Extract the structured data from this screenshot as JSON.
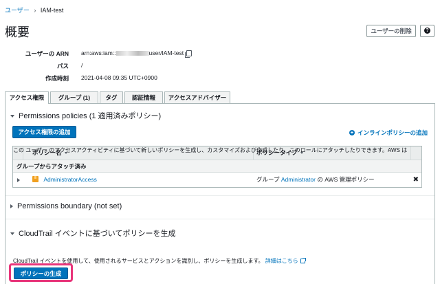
{
  "breadcrumb": {
    "users": "ユーザー",
    "separator": "›",
    "current": "IAM-test"
  },
  "header": {
    "title": "概要",
    "delete_button": "ユーザーの削除",
    "help_glyph": "?"
  },
  "summary": {
    "arn": {
      "label": "ユーザーの ARN",
      "prefix": "arn:aws:iam::",
      "suffix": "user/IAM-test"
    },
    "path": {
      "label": "パス",
      "value": "/"
    },
    "created": {
      "label": "作成時刻",
      "value": "2021-04-08 09:35 UTC+0900"
    }
  },
  "tabs": [
    {
      "label": "アクセス権限",
      "active": true
    },
    {
      "label": "グループ (1)",
      "active": false
    },
    {
      "label": "タグ",
      "active": false
    },
    {
      "label": "認証情報",
      "active": false
    },
    {
      "label": "アクセスアドバイザー",
      "active": false
    }
  ],
  "permissions": {
    "section_title": "Permissions policies (1 適用済みポリシー)",
    "add_button": "アクセス権限の追加",
    "inline_policy": "インラインポリシーの追加",
    "columns": [
      "ポリシー名",
      "ポリシータイプ"
    ],
    "group_row": "グループからアタッチ済み",
    "policy": {
      "name": "AdministratorAccess",
      "type_prefix": "グループ",
      "type_link": "Administrator",
      "type_suffix": "の AWS 管理ポリシー"
    }
  },
  "boundary": {
    "section_title": "Permissions boundary (not set)"
  },
  "cloudtrail": {
    "section_title": "CloudTrail イベントに基づいてポリシーを生成",
    "desc_line1": "この ユーザー のアクセスアクティビティに基づいて新しいポリシーを生成し、カスタマイズおよび作成したり、このロールにアタッチしたりできます。AWS は",
    "desc_line2": "CloudTrail イベントを使用して、使用されるサービスとアクションを識別し、ポリシーを生成します。",
    "learn_more": "詳細はこちら",
    "generate_button": "ポリシーの生成"
  },
  "colors": {
    "accent": "#0073bb",
    "highlight": "#e8357a",
    "policy_icon": "#f0a020"
  }
}
